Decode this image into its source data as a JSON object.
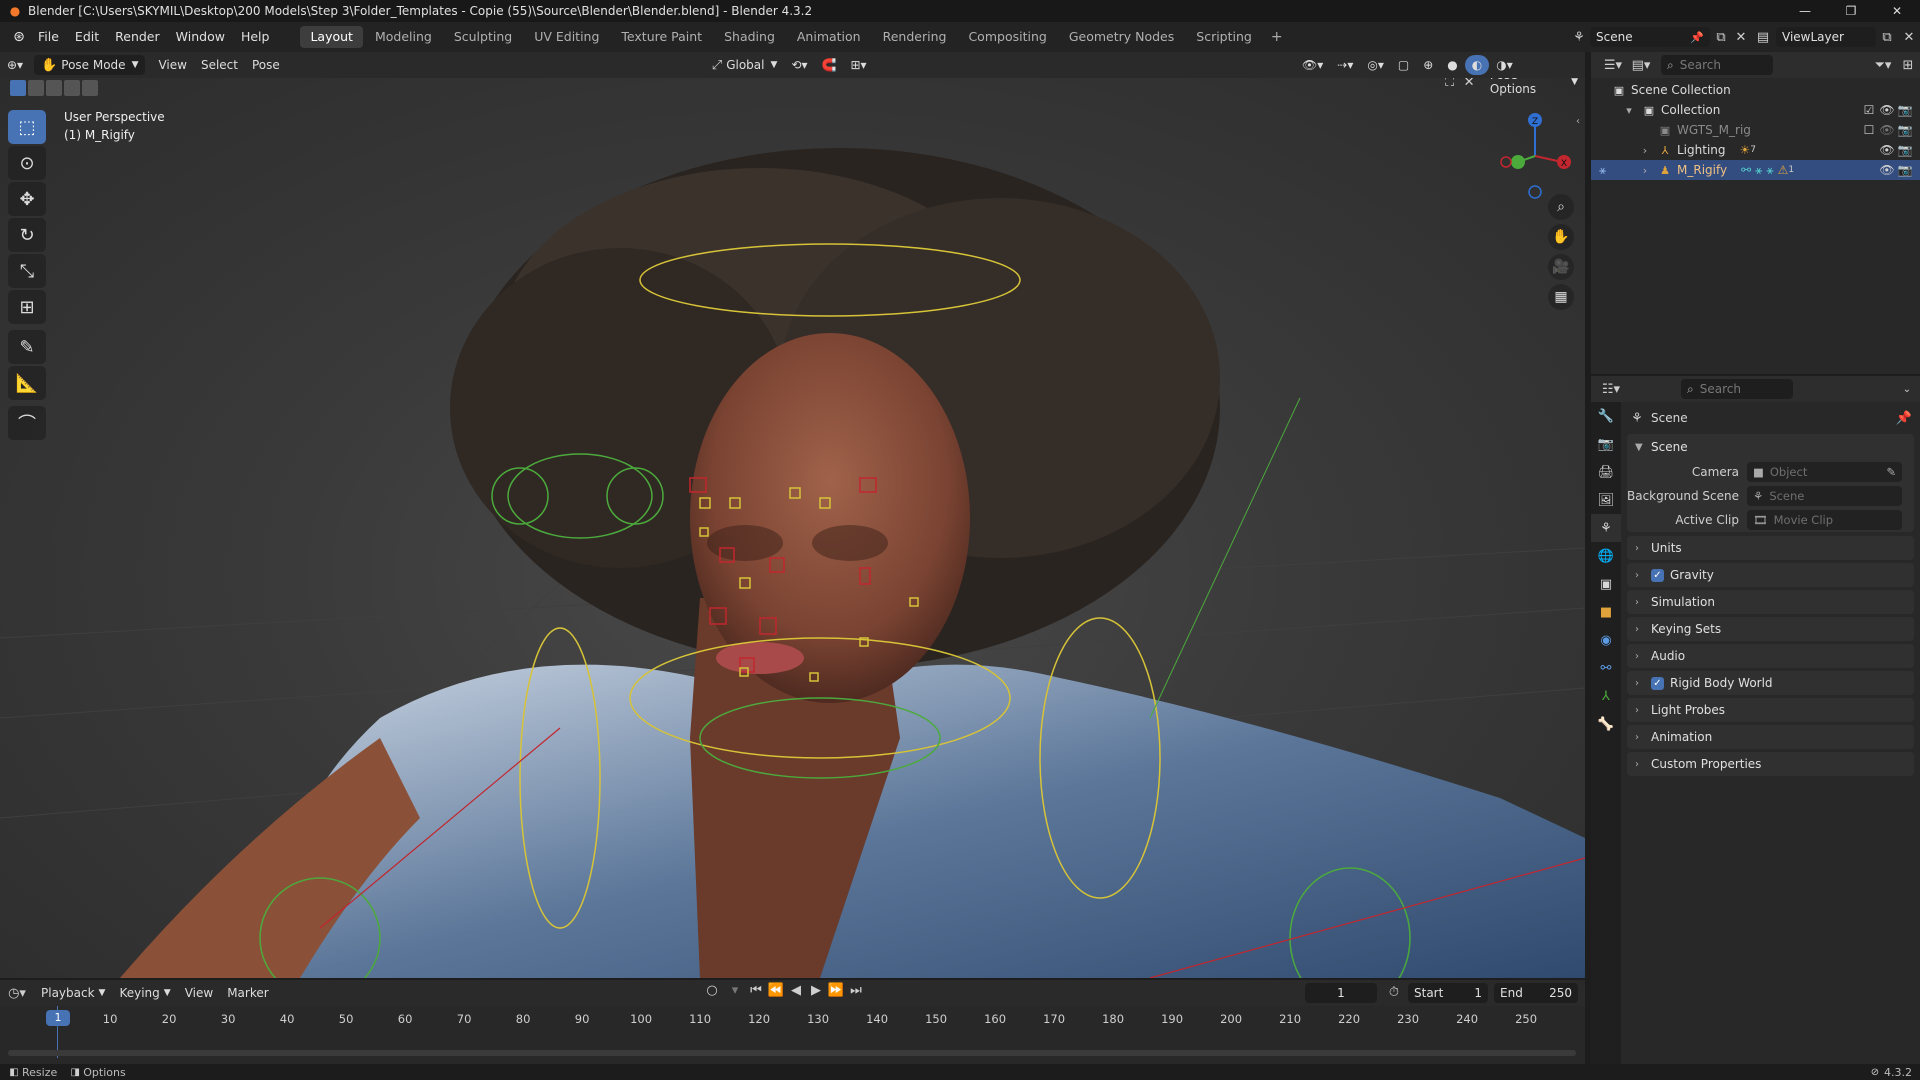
{
  "title": {
    "text": "Blender [C:\\Users\\SKYMIL\\Desktop\\200 Models\\Step 3\\Folder_Templates - Copie (55)\\Source\\Blender\\Blender.blend] - Blender 4.3.2"
  },
  "menu": {
    "items": [
      "File",
      "Edit",
      "Render",
      "Window",
      "Help"
    ]
  },
  "workspaces": [
    "Layout",
    "Modeling",
    "Sculpting",
    "UV Editing",
    "Texture Paint",
    "Shading",
    "Animation",
    "Rendering",
    "Compositing",
    "Geometry Nodes",
    "Scripting"
  ],
  "scene_selector": {
    "value": "Scene"
  },
  "viewlayer_selector": {
    "value": "ViewLayer"
  },
  "viewport_header": {
    "mode": "Pose Mode",
    "menus": [
      "View",
      "Select",
      "Pose"
    ],
    "orientation": "Global",
    "pose_options": "Pose Options"
  },
  "viewport": {
    "perspective_label": "User Perspective",
    "object_label": "(1) M_Rigify",
    "gizmo_axes": {
      "z": "Z",
      "x": "X"
    }
  },
  "outliner": {
    "search_placeholder": "Search",
    "rows": [
      {
        "label": "Scene Collection"
      },
      {
        "label": "Collection"
      },
      {
        "label": "WGTS_M_rig"
      },
      {
        "label": "Lighting",
        "badge": "7"
      },
      {
        "label": "M_Rigify",
        "badge": "1"
      }
    ]
  },
  "properties": {
    "search_placeholder": "Search",
    "context_title": "Scene",
    "panel_scene_title": "Scene",
    "fields": [
      {
        "label": "Camera",
        "placeholder": "Object"
      },
      {
        "label": "Background Scene",
        "placeholder": "Scene"
      },
      {
        "label": "Active Clip",
        "placeholder": "Movie Clip"
      }
    ],
    "collapsed_panels": [
      {
        "label": "Units",
        "checkbox": false
      },
      {
        "label": "Gravity",
        "checkbox": true
      },
      {
        "label": "Simulation",
        "checkbox": false
      },
      {
        "label": "Keying Sets",
        "checkbox": false
      },
      {
        "label": "Audio",
        "checkbox": false
      },
      {
        "label": "Rigid Body World",
        "checkbox": true
      },
      {
        "label": "Light Probes",
        "checkbox": false
      },
      {
        "label": "Animation",
        "checkbox": false
      },
      {
        "label": "Custom Properties",
        "checkbox": false
      }
    ]
  },
  "timeline": {
    "menus": [
      "Playback",
      "Keying",
      "View",
      "Marker"
    ],
    "current_frame": "1",
    "start_label": "Start",
    "start_value": "1",
    "end_label": "End",
    "end_value": "250",
    "ruler": [
      "1",
      "10",
      "20",
      "30",
      "40",
      "50",
      "60",
      "70",
      "80",
      "90",
      "100",
      "110",
      "120",
      "130",
      "140",
      "150",
      "160",
      "170",
      "180",
      "190",
      "200",
      "210",
      "220",
      "230",
      "240",
      "250"
    ]
  },
  "statusbar": {
    "left_items": [
      "Resize",
      "Options"
    ],
    "version": "4.3.2"
  },
  "colors": {
    "accent": "#4772b3",
    "selected_row": "#334d80",
    "current_frame": "#4772b3",
    "rig_yellow": "#d6c338",
    "rig_green": "#4caa3d",
    "rig_red": "#c2262e"
  }
}
